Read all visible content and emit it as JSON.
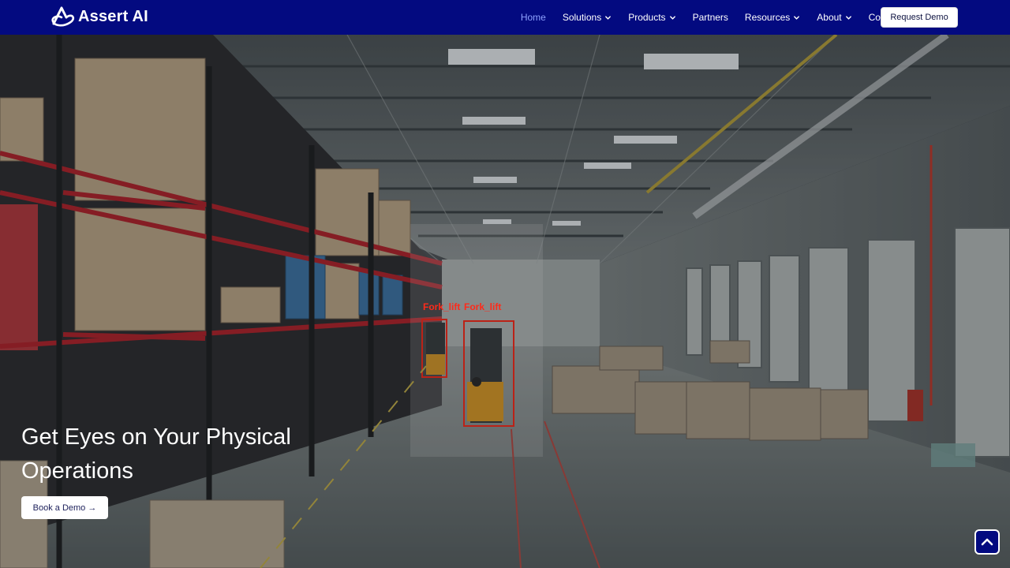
{
  "brand": {
    "name": "Assert AI",
    "logo_icon": "assert-logo-icon"
  },
  "nav": {
    "items": [
      {
        "label": "Home",
        "active": true,
        "dropdown": false
      },
      {
        "label": "Solutions",
        "active": false,
        "dropdown": true
      },
      {
        "label": "Products",
        "active": false,
        "dropdown": true
      },
      {
        "label": "Partners",
        "active": false,
        "dropdown": false
      },
      {
        "label": "Resources",
        "active": false,
        "dropdown": true
      },
      {
        "label": "About",
        "active": false,
        "dropdown": true
      },
      {
        "label": "Contact",
        "active": false,
        "dropdown": false
      }
    ],
    "cta": "Request Demo"
  },
  "hero": {
    "title": "Get Eyes on Your Physical Operations",
    "button": "Book a Demo →",
    "detections": [
      "Fork_lift",
      "Fork_lift"
    ]
  },
  "colors": {
    "nav_bg": "#030a80",
    "active_link": "#8ea2ff",
    "detection_box": "#ff2a1a"
  },
  "icons": {
    "scroll_top": "chevron-up-icon"
  }
}
